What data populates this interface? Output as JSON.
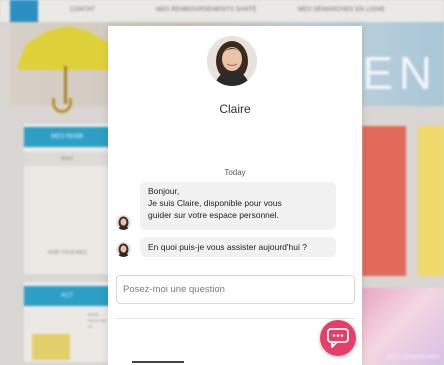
{
  "background_page": {
    "nav_items": [
      "CONTAT",
      "MES REMBOURSEMENTS SANTÉ",
      "MES DÉMARCHES EN LIGNE"
    ],
    "hero_text": "VEN",
    "left_panel_title": "MES REMB",
    "left_panel_sub": "Retro",
    "left_panel_footer": "VOIR TOUS MES",
    "left_panel2_title": "ACT",
    "left_panel2_lines": "BÉNÉ PROV EN DI",
    "right_bottom_text": "MES DÉMARCHES",
    "colors": {
      "accent_blue": "#2d9fc6",
      "red_tile": "#e26a5a",
      "yellow_tile": "#f0d86a"
    }
  },
  "chat": {
    "agent_name": "Claire",
    "day_label": "Today",
    "messages": [
      {
        "lines": [
          "Bonjour,",
          "Je suis Claire, disponible pour vous",
          "guider sur votre espace personnel."
        ]
      },
      {
        "lines": [
          "En quoi puis-je vous assister aujourd'hui ?"
        ]
      }
    ],
    "input_placeholder": "Posez-moi une question",
    "launcher_icon": "chat-bubble-icon",
    "colors": {
      "launcher": "#e83d6b",
      "bubble": "#f1f1f1"
    }
  }
}
